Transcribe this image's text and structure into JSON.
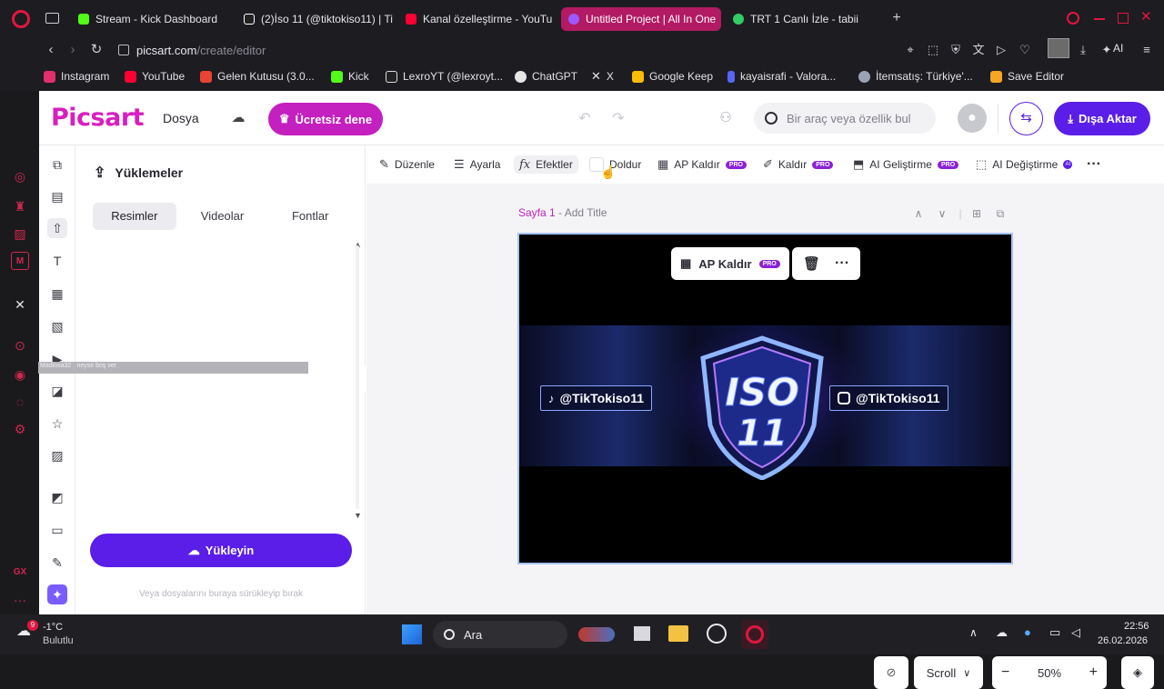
{
  "browser": {
    "tabs": [
      {
        "label": "Stream - Kick Dashboard",
        "color": "#53fc18"
      },
      {
        "label": "(2)İso 11 (@tiktokiso11) | Ti",
        "color": "#ffffff"
      },
      {
        "label": "Kanal özelleştirme - YouTu",
        "color": "#ff0033"
      },
      {
        "label": "Untitled Project | All In One",
        "color": "#9b59ff"
      },
      {
        "label": "TRT 1 Canlı İzle - tabii",
        "color": "#33cc66"
      }
    ],
    "url_host": "picsart.com",
    "url_path": "/create/editor",
    "ai_label": "AI",
    "bookmarks": [
      {
        "label": "Instagram",
        "color": "#e1306c"
      },
      {
        "label": "YouTube",
        "color": "#ff0033"
      },
      {
        "label": "Gelen Kutusu (3.0...",
        "color": "#ea4335"
      },
      {
        "label": "Kick",
        "color": "#53fc18"
      },
      {
        "label": "LexroYT (@lexroyt...",
        "color": "#ffffff"
      },
      {
        "label": "ChatGPT",
        "color": "#ffffff"
      },
      {
        "label": "X",
        "color": "#ffffff"
      },
      {
        "label": "Google Keep",
        "color": "#fbbc04"
      },
      {
        "label": "kayaisrafi - Valora...",
        "color": "#5865f2"
      },
      {
        "label": "İtemsatış: Türkiye'...",
        "color": "#9aa3b5"
      },
      {
        "label": "Save Editor",
        "color": "#f5a623"
      }
    ]
  },
  "header": {
    "logo": "Picsart",
    "file_menu": "Dosya",
    "free_button": "Ücretsiz dene",
    "search_placeholder": "Bir araç veya özellik bul",
    "export_button": "Dışa Aktar"
  },
  "panel": {
    "title": "Yüklemeler",
    "tabs": [
      "Resimler",
      "Videolar",
      "Fontlar"
    ],
    "overlay_text": "Madiosa32 · neyse boş ver",
    "upload_button": "Yükleyin",
    "drop_hint": "Veya dosyalarını buraya sürükleyip bırak"
  },
  "toolbar": {
    "items": [
      {
        "label": "Düzenle",
        "pro": false
      },
      {
        "label": "Ayarla",
        "pro": false
      },
      {
        "label": "Efektler",
        "pro": false
      },
      {
        "label": "Doldur",
        "pro": false
      },
      {
        "label": "AP Kaldır",
        "pro": true
      },
      {
        "label": "Kaldır",
        "pro": true
      },
      {
        "label": "AI Geliştirme",
        "pro": true
      },
      {
        "label": "AI Değiştirme",
        "pro": false
      }
    ],
    "pro_badge": "PRO",
    "ai_badge": "AI"
  },
  "canvas": {
    "page_number": "Sayfa 1",
    "separator": " - ",
    "page_title_placeholder": "Add Title",
    "context_action": "AP Kaldır",
    "context_pro": "PRO",
    "handle_left": "@TikTokiso11",
    "handle_right": "@TikTokiso11",
    "logo_line1": "ISO",
    "logo_line2": "11"
  },
  "bottom": {
    "scroll_label": "Scroll",
    "zoom": "50%"
  },
  "taskbar": {
    "badge": "9",
    "temperature": "-1°C",
    "weather": "Bulutlu",
    "search": "Ara",
    "time": "22:56",
    "date": "26.02.2026"
  }
}
